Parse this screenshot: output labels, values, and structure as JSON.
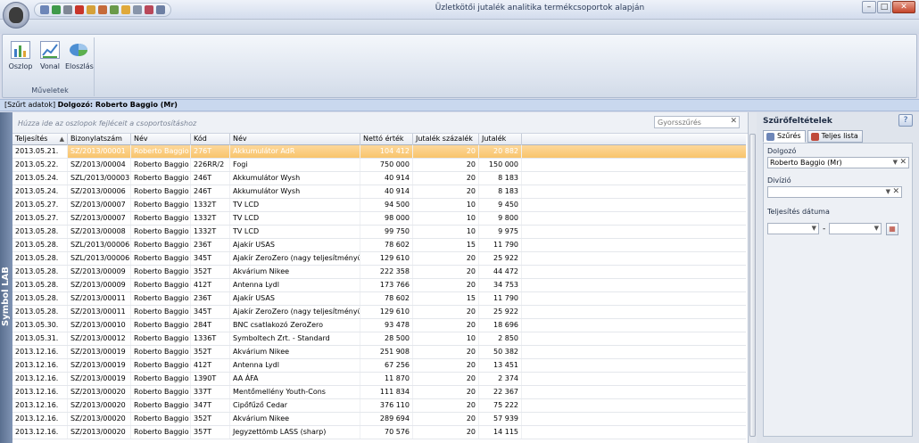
{
  "window": {
    "title": "Üzletkötői jutalék analitika termékcsoportok alapján"
  },
  "ribbon": {
    "group_label": "Műveletek",
    "buttons": [
      {
        "label": "Oszlop",
        "icon": "bar-chart-icon"
      },
      {
        "label": "Vonal",
        "icon": "line-chart-icon"
      },
      {
        "label": "Eloszlás",
        "icon": "pie-chart-icon"
      }
    ]
  },
  "filter_info": {
    "prefix": "[Szűrt adatok]",
    "text": "Dolgozó: Roberto Baggio (Mr)"
  },
  "side_strip": {
    "label": "Symbol LAB"
  },
  "grid": {
    "group_hint": "Húzza ide az oszlopok fejléceit a csoportosításhoz",
    "quick_search_placeholder": "Gyorsszűrés",
    "columns": [
      "Teljesítés",
      "Bizonylatszám",
      "Név",
      "Kód",
      "Név",
      "Nettó érték",
      "Jutalék százalék",
      "Jutalék"
    ],
    "sorted_column": 0,
    "selected_row": 0,
    "rows": [
      [
        "2013.05.21.",
        "SZ/2013/00001",
        "Roberto Baggio",
        "276T",
        "Akkumulátor AdR",
        "104 412",
        "20",
        "20 882"
      ],
      [
        "2013.05.22.",
        "SZ/2013/00004",
        "Roberto Baggio",
        "226RR/2",
        "Fogi",
        "750 000",
        "20",
        "150 000"
      ],
      [
        "2013.05.24.",
        "SZL/2013/00003",
        "Roberto Baggio",
        "246T",
        "Akkumulátor Wysh",
        "40 914",
        "20",
        "8 183"
      ],
      [
        "2013.05.24.",
        "SZ/2013/00006",
        "Roberto Baggio",
        "246T",
        "Akkumulátor Wysh",
        "40 914",
        "20",
        "8 183"
      ],
      [
        "2013.05.27.",
        "SZ/2013/00007",
        "Roberto Baggio",
        "1332T",
        "TV LCD",
        "94 500",
        "10",
        "9 450"
      ],
      [
        "2013.05.27.",
        "SZ/2013/00007",
        "Roberto Baggio",
        "1332T",
        "TV LCD",
        "98 000",
        "10",
        "9 800"
      ],
      [
        "2013.05.28.",
        "SZ/2013/00008",
        "Roberto Baggio",
        "1332T",
        "TV LCD",
        "99 750",
        "10",
        "9 975"
      ],
      [
        "2013.05.28.",
        "SZL/2013/00006",
        "Roberto Baggio",
        "236T",
        "Ajakír USAS",
        "78 602",
        "15",
        "11 790"
      ],
      [
        "2013.05.28.",
        "SZL/2013/00006",
        "Roberto Baggio",
        "345T",
        "Ajakír ZeroZero (nagy teljesítményű)",
        "129 610",
        "20",
        "25 922"
      ],
      [
        "2013.05.28.",
        "SZ/2013/00009",
        "Roberto Baggio",
        "352T",
        "Akvárium Nikee",
        "222 358",
        "20",
        "44 472"
      ],
      [
        "2013.05.28.",
        "SZ/2013/00009",
        "Roberto Baggio",
        "412T",
        "Antenna Lydl",
        "173 766",
        "20",
        "34 753"
      ],
      [
        "2013.05.28.",
        "SZ/2013/00011",
        "Roberto Baggio",
        "236T",
        "Ajakír USAS",
        "78 602",
        "15",
        "11 790"
      ],
      [
        "2013.05.28.",
        "SZ/2013/00011",
        "Roberto Baggio",
        "345T",
        "Ajakír ZeroZero (nagy teljesítményű)",
        "129 610",
        "20",
        "25 922"
      ],
      [
        "2013.05.30.",
        "SZ/2013/00010",
        "Roberto Baggio",
        "284T",
        "BNC csatlakozó ZeroZero",
        "93 478",
        "20",
        "18 696"
      ],
      [
        "2013.05.31.",
        "SZ/2013/00012",
        "Roberto Baggio",
        "1336T",
        "Symboltech Zrt. - Standard",
        "28 500",
        "10",
        "2 850"
      ],
      [
        "2013.12.16.",
        "SZ/2013/00019",
        "Roberto Baggio",
        "352T",
        "Akvárium Nikee",
        "251 908",
        "20",
        "50 382"
      ],
      [
        "2013.12.16.",
        "SZ/2013/00019",
        "Roberto Baggio",
        "412T",
        "Antenna Lydl",
        "67 256",
        "20",
        "13 451"
      ],
      [
        "2013.12.16.",
        "SZ/2013/00019",
        "Roberto Baggio",
        "1390T",
        "AA ÁFA",
        "11 870",
        "20",
        "2 374"
      ],
      [
        "2013.12.16.",
        "SZ/2013/00020",
        "Roberto Baggio",
        "337T",
        "Mentőmellény Youth-Cons",
        "111 834",
        "20",
        "22 367"
      ],
      [
        "2013.12.16.",
        "SZ/2013/00020",
        "Roberto Baggio",
        "347T",
        "Cipőfűző Cedar",
        "376 110",
        "20",
        "75 222"
      ],
      [
        "2013.12.16.",
        "SZ/2013/00020",
        "Roberto Baggio",
        "352T",
        "Akvárium Nikee",
        "289 694",
        "20",
        "57 939"
      ],
      [
        "2013.12.16.",
        "SZ/2013/00020",
        "Roberto Baggio",
        "357T",
        "Jegyzettömb LASS (sharp)",
        "70 576",
        "20",
        "14 115"
      ]
    ]
  },
  "filter_panel": {
    "title": "Szűrőfeltételek",
    "tabs": [
      "Szűrés",
      "Teljes lista"
    ],
    "employee_label": "Dolgozó",
    "employee_value": "Roberto Baggio (Mr)",
    "division_label": "Divízió",
    "division_value": "",
    "date_label": "Teljesítés dátuma",
    "date_separator": "-"
  },
  "colors": {
    "selected_row": "#f8c46c",
    "accent": "#c9d8ee"
  }
}
